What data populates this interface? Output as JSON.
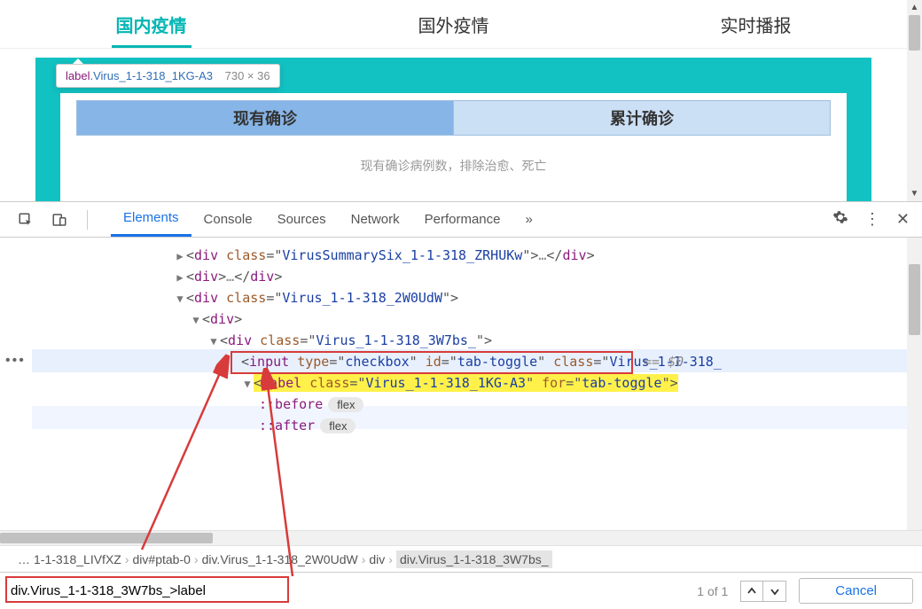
{
  "webpage": {
    "nav_tabs": [
      "国内疫情",
      "国外疫情",
      "实时播报"
    ],
    "tooltip": {
      "selector_prefix": "label",
      "selector_class": ".Virus_1-1-318_1KG-A3",
      "dimensions": "730 × 36"
    },
    "sub_tabs": [
      "现有确诊",
      "累计确诊"
    ],
    "sub_desc": "现有确诊病例数，排除治愈、死亡"
  },
  "devtools": {
    "tabs": [
      "Elements",
      "Console",
      "Sources",
      "Network",
      "Performance"
    ],
    "overflow": "»",
    "dom": {
      "l1": {
        "cls": "VirusSummarySix_1-1-318_ZRHUKw"
      },
      "l3": {
        "cls": "Virus_1-1-318_2W0UdW"
      },
      "l5": {
        "cls": "Virus_1-1-318_3W7bs_"
      },
      "l5_marker": "== $0",
      "l6": {
        "type": "checkbox",
        "id": "tab-toggle",
        "cls_partial": "Virus_1-1-318_"
      },
      "l7": {
        "cls": "Virus_1-1-318_1KG-A3",
        "for": "tab-toggle"
      },
      "pseudo_before": "::before",
      "pseudo_after": "::after",
      "pill": "flex"
    },
    "gutter_dots": "•••",
    "breadcrumbs": {
      "leading": "…",
      "items": [
        "1-1-318_LIVfXZ",
        "div#ptab-0",
        "div.Virus_1-1-318_2W0UdW",
        "div",
        "div.Virus_1-1-318_3W7bs_"
      ]
    },
    "search": {
      "value": "div.Virus_1-1-318_3W7bs_>label",
      "count": "1 of 1",
      "cancel": "Cancel"
    }
  }
}
